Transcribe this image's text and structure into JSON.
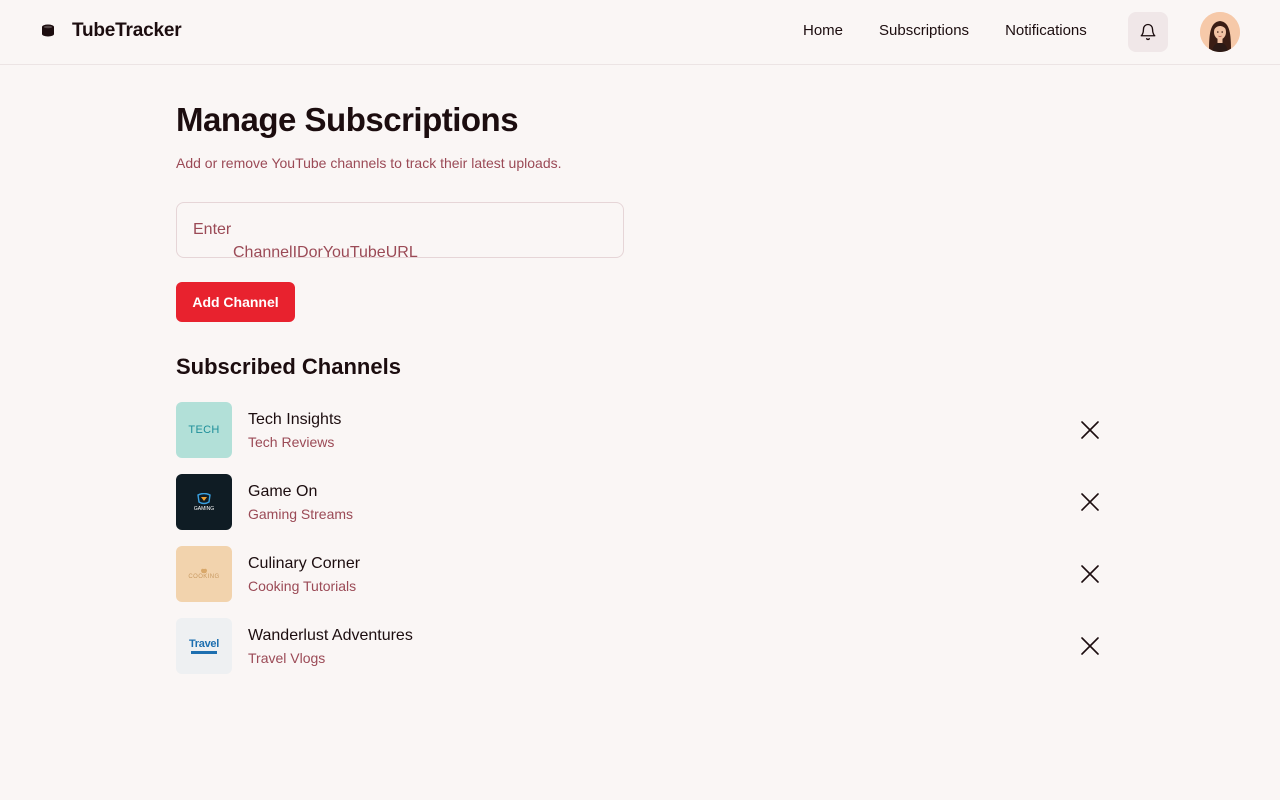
{
  "app": {
    "name": "TubeTracker"
  },
  "nav": {
    "items": [
      "Home",
      "Subscriptions",
      "Notifications"
    ]
  },
  "page": {
    "title": "Manage Subscriptions",
    "subtitle": "Add or remove YouTube channels to track their latest uploads."
  },
  "form": {
    "placeholder_line1": "Enter",
    "placeholder_line2": "ChannelIDorYouTubeURL",
    "add_button": "Add Channel"
  },
  "section": {
    "title": "Subscribed Channels"
  },
  "channels": [
    {
      "name": "Tech Insights",
      "category": "Tech Reviews",
      "thumb_text": "TECH",
      "thumb_bg": "#b2e0d8",
      "thumb_fg": "#1f8f9a"
    },
    {
      "name": "Game On",
      "category": "Gaming Streams",
      "thumb_text": "GAMING",
      "thumb_bg": "#0f1c24",
      "thumb_fg": "#ffffff"
    },
    {
      "name": "Culinary Corner",
      "category": "Cooking Tutorials",
      "thumb_text": "COOKING",
      "thumb_bg": "#f2d3ad",
      "thumb_fg": "#c99a62"
    },
    {
      "name": "Wanderlust Adventures",
      "category": "Travel Vlogs",
      "thumb_text": "Travel",
      "thumb_bg": "#eef0f2",
      "thumb_fg": "#1d6fb0"
    }
  ],
  "colors": {
    "accent": "#e8222e",
    "muted_text": "#9b4a56",
    "background": "#faf6f5"
  },
  "icons": {
    "brand": "cylinder-icon",
    "notifications": "bell-icon",
    "remove": "close-icon"
  }
}
